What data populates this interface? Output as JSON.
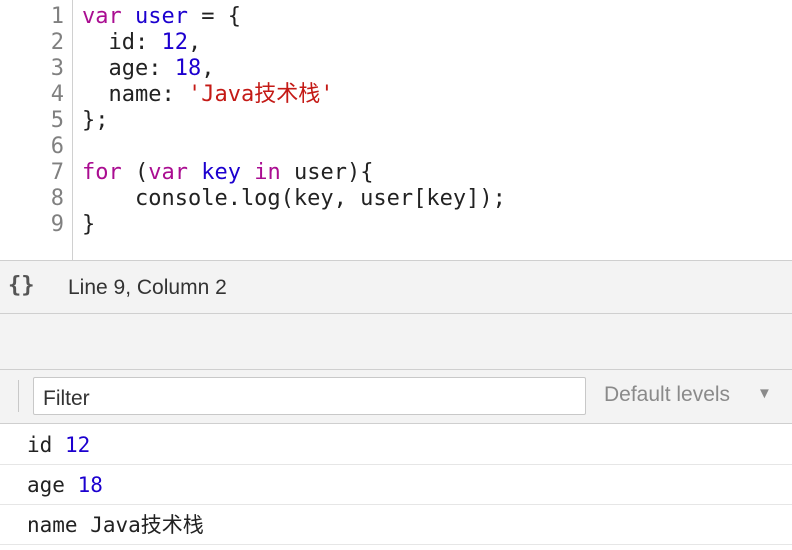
{
  "editor": {
    "lines": [
      {
        "n": "1",
        "parts": [
          {
            "t": "var",
            "c": "kw"
          },
          {
            "t": " ",
            "c": "punc"
          },
          {
            "t": "user",
            "c": "var"
          },
          {
            "t": " = {",
            "c": "punc"
          }
        ]
      },
      {
        "n": "2",
        "parts": [
          {
            "t": "  id: ",
            "c": "punc"
          },
          {
            "t": "12",
            "c": "num"
          },
          {
            "t": ",",
            "c": "punc"
          }
        ]
      },
      {
        "n": "3",
        "parts": [
          {
            "t": "  age: ",
            "c": "punc"
          },
          {
            "t": "18",
            "c": "num"
          },
          {
            "t": ",",
            "c": "punc"
          }
        ]
      },
      {
        "n": "4",
        "parts": [
          {
            "t": "  name: ",
            "c": "punc"
          },
          {
            "t": "'Java技术栈'",
            "c": "str"
          }
        ]
      },
      {
        "n": "5",
        "parts": [
          {
            "t": "};",
            "c": "punc"
          }
        ]
      },
      {
        "n": "6",
        "parts": [
          {
            "t": "",
            "c": "punc"
          }
        ]
      },
      {
        "n": "7",
        "parts": [
          {
            "t": "for",
            "c": "kw"
          },
          {
            "t": " (",
            "c": "punc"
          },
          {
            "t": "var",
            "c": "kw"
          },
          {
            "t": " ",
            "c": "punc"
          },
          {
            "t": "key",
            "c": "var"
          },
          {
            "t": " ",
            "c": "punc"
          },
          {
            "t": "in",
            "c": "kw"
          },
          {
            "t": " user){",
            "c": "punc"
          }
        ]
      },
      {
        "n": "8",
        "parts": [
          {
            "t": "    console.log(key, user[key]);",
            "c": "punc"
          }
        ]
      },
      {
        "n": "9",
        "parts": [
          {
            "t": "}",
            "c": "punc"
          }
        ]
      }
    ]
  },
  "status": {
    "braces": "{}",
    "position": "Line 9, Column 2"
  },
  "console": {
    "filter_placeholder": "Filter",
    "levels_label": "Default levels",
    "levels_arrow": "▼",
    "messages": [
      {
        "key": "id",
        "value": "12",
        "value_color": "#1c00cf"
      },
      {
        "key": "age",
        "value": "18",
        "value_color": "#1c00cf"
      },
      {
        "key": "name",
        "value": "Java技术栈",
        "value_color": "#222222"
      }
    ]
  }
}
